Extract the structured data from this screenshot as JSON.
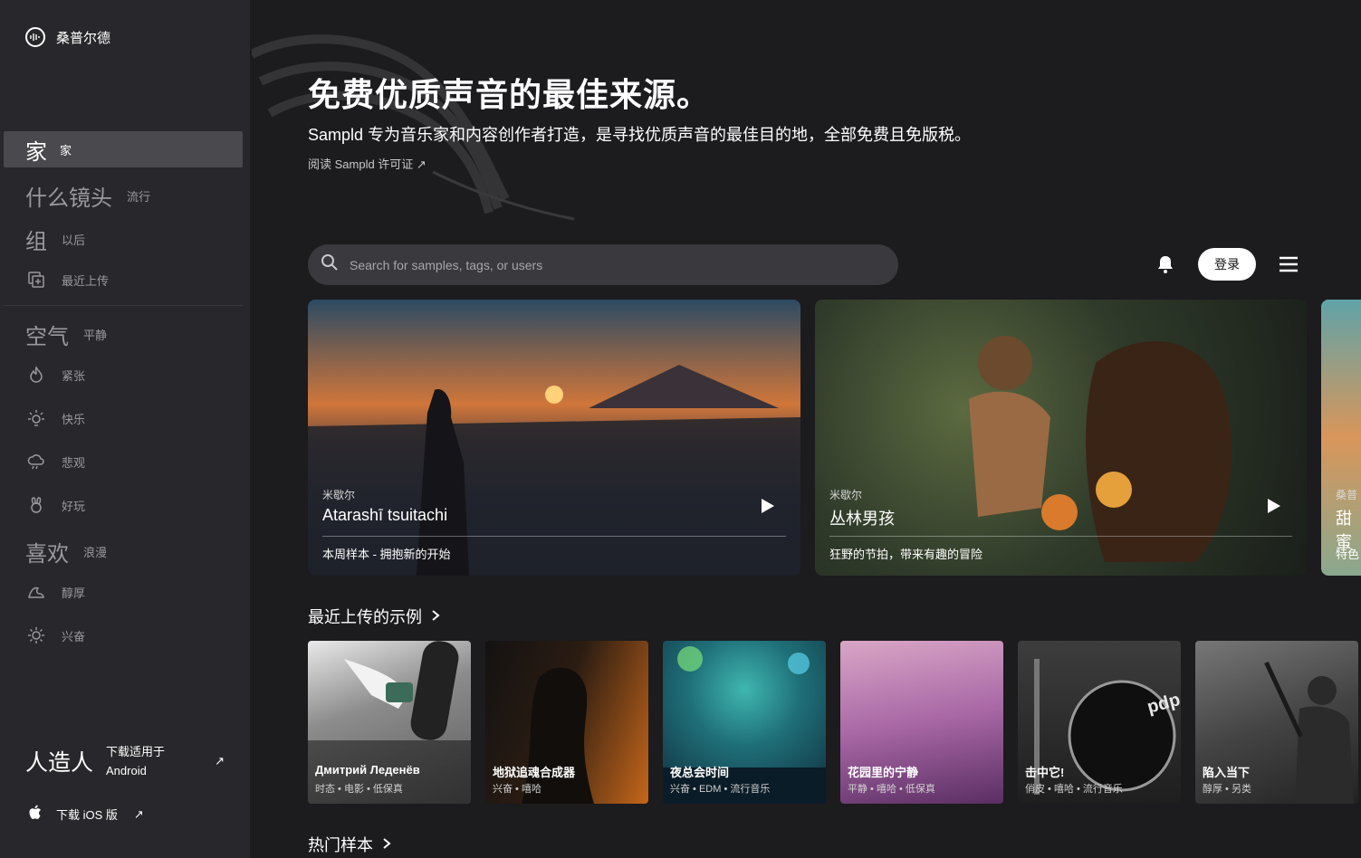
{
  "brand": {
    "name": "桑普尔德"
  },
  "sidebar": {
    "items": [
      {
        "big": "家",
        "label": "家"
      },
      {
        "big": "什么镜头",
        "label": "流行"
      },
      {
        "big": "组",
        "label": "以后"
      },
      {
        "label": "最近上传",
        "icon": "recent-upload-icon"
      },
      {
        "big": "空气",
        "label": "平静"
      },
      {
        "label": "紧张",
        "icon": "fire-icon"
      },
      {
        "label": "快乐",
        "icon": "smile-icon"
      },
      {
        "label": "悲观",
        "icon": "rain-cloud-icon"
      },
      {
        "label": "好玩",
        "icon": "bunny-icon"
      },
      {
        "big": "喜欢",
        "label": "浪漫"
      },
      {
        "label": "醇厚",
        "icon": "wave-icon"
      },
      {
        "label": "兴奋",
        "icon": "sun-icon"
      }
    ],
    "android": {
      "big": "人造人",
      "line1": "下载适用于",
      "line2": "Android",
      "arrow": "↗"
    },
    "ios": {
      "label": "下载 iOS 版",
      "arrow": "↗"
    }
  },
  "hero": {
    "title": "免费优质声音的最佳来源。",
    "subtitle": "Sampld 专为音乐家和内容创作者打造，是寻找优质声音的最佳目的地，全部免费且免版税。",
    "link": "阅读 Sampld 许可证  ↗"
  },
  "search": {
    "placeholder": "Search for samples, tags, or users"
  },
  "header": {
    "login": "登录"
  },
  "featured": [
    {
      "artist": "米歇尔",
      "title": "Atarashī tsuitachi",
      "desc": "本周样本 - 拥抱新的开始"
    },
    {
      "artist": "米歇尔",
      "title": "丛林男孩",
      "desc": "狂野的节拍，带来有趣的冒险"
    },
    {
      "artist": "桑普",
      "title": "甜蜜",
      "desc": "特色"
    }
  ],
  "recent": {
    "title": "最近上传的示例",
    "cards": [
      {
        "title": "Дмитрий Леденёв",
        "tags": "时态 • 电影 • 低保真"
      },
      {
        "title": "地狱追魂合成器",
        "tags": "兴奋 • 嘻哈"
      },
      {
        "title": "夜总会时间",
        "tags": "兴奋 • EDM • 流行音乐"
      },
      {
        "title": "花园里的宁静",
        "tags": "平静 • 嘻哈 • 低保真"
      },
      {
        "title": "击中它!",
        "tags": "俏皮 • 嘻哈 • 流行音乐"
      },
      {
        "title": "陷入当下",
        "tags": "醇厚 • 另类"
      }
    ]
  },
  "popular": {
    "title": "热门样本"
  },
  "colors": {
    "background": "#1c1b1e",
    "sidebar": "#28272b",
    "active": "#4a494d",
    "search": "#3a393e"
  }
}
